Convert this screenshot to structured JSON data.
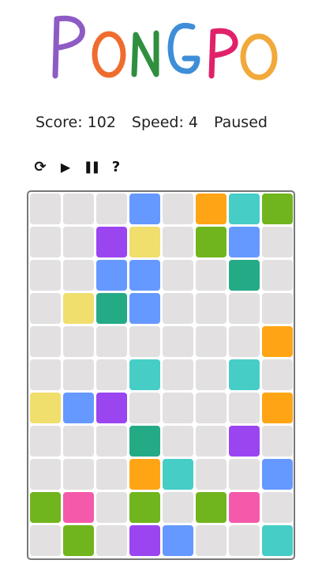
{
  "app": {
    "logo_letters": [
      "P",
      "O",
      "N",
      "G",
      "P",
      "O"
    ],
    "logo_colors": [
      "#8e5bc4",
      "#ef6c2f",
      "#2f8f3f",
      "#3e8ed7",
      "#e0226a",
      "#f2a93b"
    ]
  },
  "status": {
    "score": "Score: 102",
    "speed": "Speed: 4",
    "state": "Paused"
  },
  "controls": [
    {
      "name": "restart-icon",
      "glyph": "⟳"
    },
    {
      "name": "play-icon",
      "glyph": "▶"
    },
    {
      "name": "pause-icon",
      "glyph": "❚❚"
    },
    {
      "name": "help-icon",
      "glyph": "?"
    }
  ],
  "colors": {
    "empty": "#e2e0e1",
    "blue": "#6699ff",
    "orange": "#ffa515",
    "teal": "#46cdc6",
    "green": "#71b51e",
    "purple": "#9b45f1",
    "yellow": "#f0de6d",
    "darkgreen": "#25aa86",
    "pink": "#f55aaa"
  },
  "board": {
    "cols": 8,
    "rows": 11,
    "grid": [
      [
        null,
        null,
        null,
        "blue",
        null,
        "orange",
        "teal",
        "green"
      ],
      [
        null,
        null,
        "purple",
        "yellow",
        null,
        "green",
        "blue",
        null
      ],
      [
        null,
        null,
        "blue",
        "blue",
        null,
        null,
        "darkgreen",
        null
      ],
      [
        null,
        "yellow",
        "darkgreen",
        "blue",
        null,
        null,
        null,
        null
      ],
      [
        null,
        null,
        null,
        null,
        null,
        null,
        null,
        "orange"
      ],
      [
        null,
        null,
        null,
        "teal",
        null,
        null,
        "teal",
        null
      ],
      [
        "yellow",
        "blue",
        "purple",
        null,
        null,
        null,
        null,
        "orange"
      ],
      [
        null,
        null,
        null,
        "darkgreen",
        null,
        null,
        "purple",
        null
      ],
      [
        null,
        null,
        null,
        "orange",
        "teal",
        null,
        null,
        "blue"
      ],
      [
        "green",
        "pink",
        null,
        "green",
        null,
        "green",
        "pink",
        null
      ],
      [
        null,
        "green",
        null,
        "purple",
        "blue",
        null,
        null,
        "teal"
      ]
    ]
  }
}
